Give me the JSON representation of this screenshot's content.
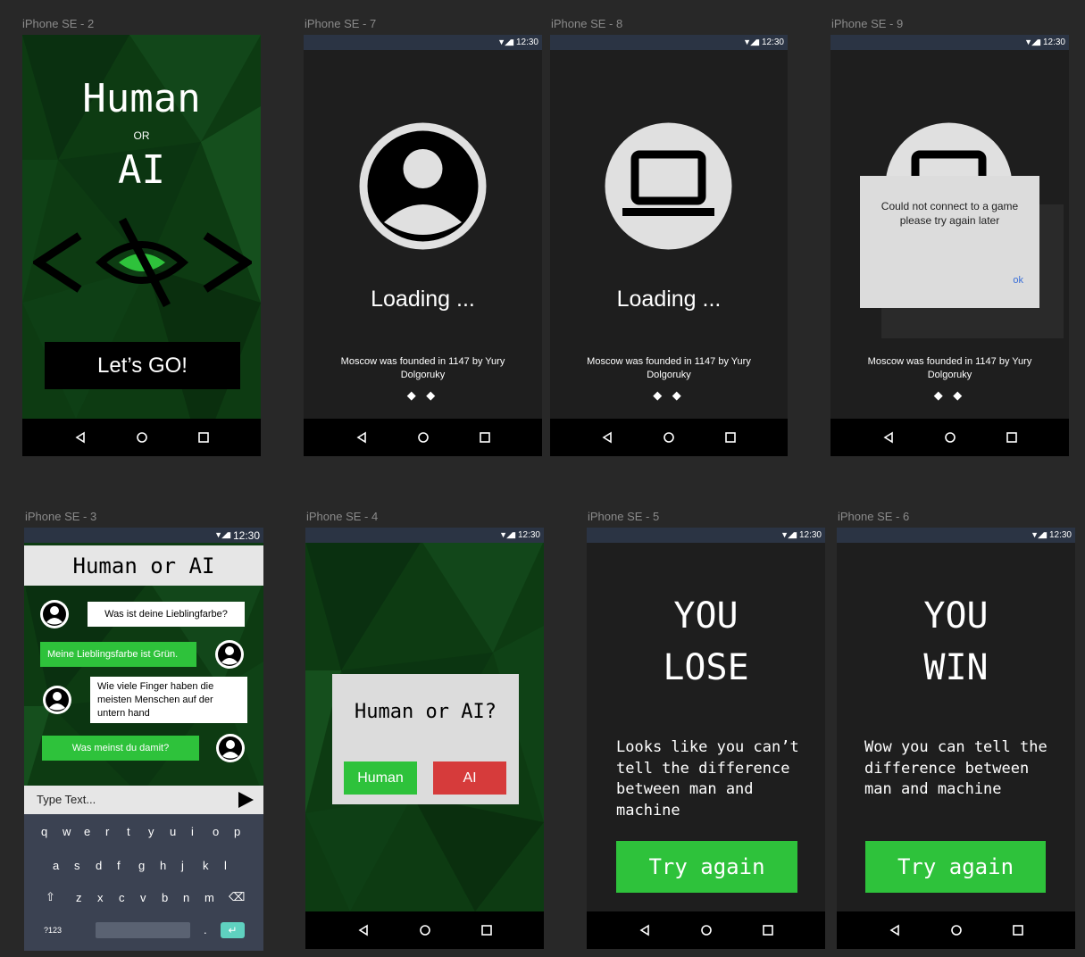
{
  "frames": {
    "f2": {
      "label": "iPhone SE - 2",
      "title_top": "Human",
      "title_or": "OR",
      "title_bottom": "AI",
      "go_button": "Let’s GO!"
    },
    "f7": {
      "label": "iPhone SE - 7",
      "loading": "Loading ...",
      "fact": "Moscow was founded in 1147 by Yury Dolgoruky",
      "dots": "◆ ◆"
    },
    "f8": {
      "label": "iPhone SE - 8",
      "loading": "Loading ...",
      "fact": "Moscow was founded in 1147 by Yury Dolgoruky",
      "dots": "◆ ◆"
    },
    "f9": {
      "label": "iPhone SE - 9",
      "fact": "Moscow was founded in 1147 by Yury Dolgoruky",
      "dots": "◆ ◆",
      "dialog_message": "Could not connect to a game please try again later",
      "dialog_ok": "ok"
    },
    "f3": {
      "label": "iPhone SE - 3",
      "header": "Human or AI",
      "messages": [
        "Was ist deine Lieblingfarbe?",
        "Meine Lieblingsfarbe ist Grün.",
        "Wie viele Finger haben die meisten Menschen auf der untern hand",
        "Was meinst du damit?"
      ],
      "input_placeholder": "Type Text...",
      "keys_row1": [
        "q",
        "w",
        "e",
        "r",
        "t",
        "y",
        "u",
        "i",
        "o",
        "p"
      ],
      "keys_row2": [
        "a",
        "s",
        "d",
        "f",
        "g",
        "h",
        "j",
        "k",
        "l"
      ],
      "keys_row3": [
        "z",
        "x",
        "c",
        "v",
        "b",
        "n",
        "m"
      ],
      "key_numbers": "?123",
      "key_period": "."
    },
    "f4": {
      "label": "iPhone SE - 4",
      "question": "Human or AI?",
      "human_button": "Human",
      "ai_button": "AI"
    },
    "f5": {
      "label": "iPhone SE - 5",
      "result_line1": "YOU",
      "result_line2": "LOSE",
      "message": "Looks like you can’t tell the difference between man and machine",
      "try_again": "Try again"
    },
    "f6": {
      "label": "iPhone SE - 6",
      "result_line1": "YOU",
      "result_line2": "WIN",
      "message": "Wow you can tell the difference between man and machine",
      "try_again": "Try again"
    }
  },
  "status_time": "12:30",
  "colors": {
    "accent_green": "#2ec23b",
    "ai_red": "#d63b3b",
    "dark_bg": "#1e1e1e",
    "status_bar": "#2b3444"
  }
}
